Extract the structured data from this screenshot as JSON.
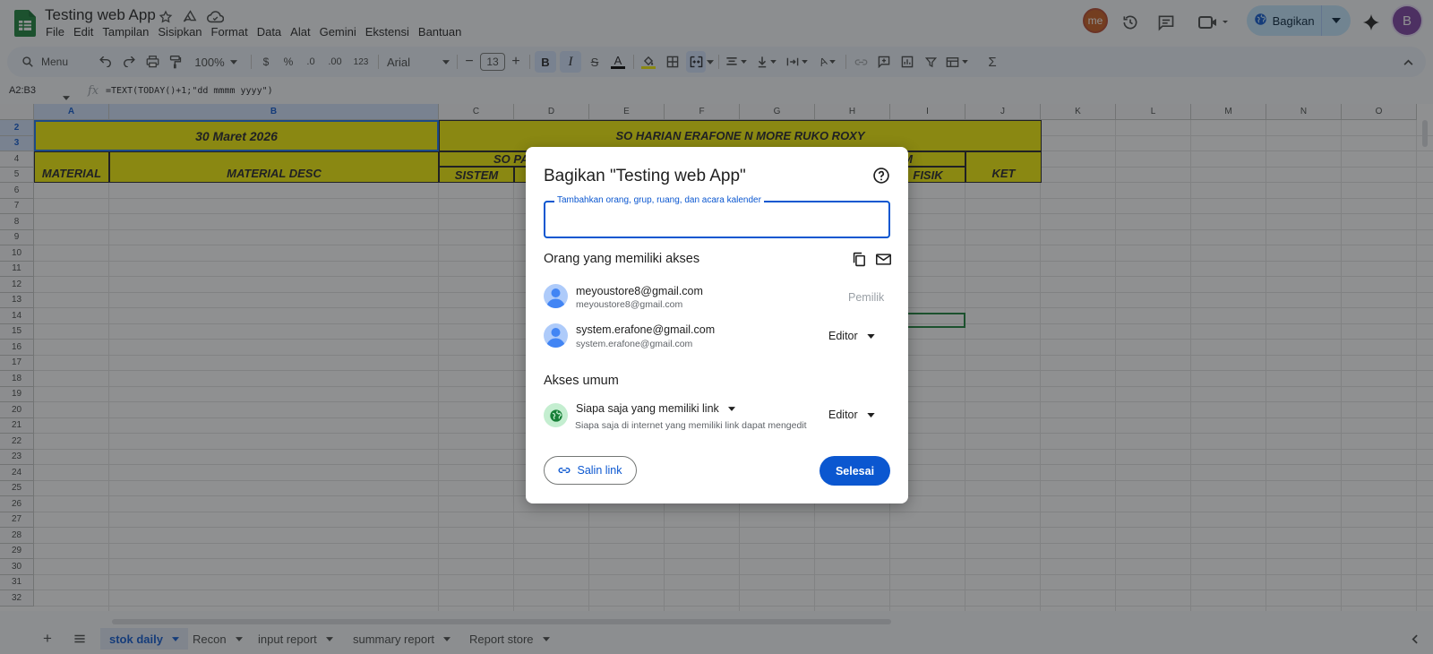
{
  "header": {
    "title": "Testing web App",
    "menu": [
      "File",
      "Edit",
      "Tampilan",
      "Sisipkan",
      "Format",
      "Data",
      "Alat",
      "Gemini",
      "Ekstensi",
      "Bantuan"
    ],
    "share_label": "Bagikan",
    "user_badge": "me",
    "account_initial": "B"
  },
  "toolbar": {
    "menu_search": "Menu",
    "zoom": "100%",
    "currency": "$",
    "percent": "%",
    "dec_minus": ".0",
    "dec_plus": ".00",
    "num_format": "123",
    "font": "Arial",
    "font_size": "13"
  },
  "formula_bar": {
    "name_box": "A2:B3",
    "formula": "=TEXT(TODAY()+1;\"dd mmmm yyyy\")"
  },
  "grid": {
    "columns": [
      "A",
      "B",
      "C",
      "D",
      "E",
      "F",
      "G",
      "H",
      "I",
      "J",
      "K",
      "L",
      "M",
      "N",
      "O"
    ],
    "rows": [
      "2",
      "3",
      "4",
      "5",
      "6",
      "7",
      "8",
      "9",
      "10",
      "11",
      "12",
      "13",
      "14",
      "15",
      "16",
      "17",
      "18",
      "19",
      "20",
      "21",
      "22",
      "23",
      "24",
      "25",
      "26",
      "27",
      "28",
      "29",
      "30",
      "31",
      "32"
    ],
    "cells": {
      "date": "30 Maret 2026",
      "material": "MATERIAL",
      "material_desc": "MATERIAL DESC",
      "title": "SO HARIAN ERAFONE N MORE RUKO ROXY",
      "so_pa": "SO PA",
      "am": "AM",
      "sistem": "SISTEM",
      "fisik": "FISIK",
      "ket": "KET"
    }
  },
  "dialog": {
    "title": "Bagikan \"Testing web App\"",
    "input_label": "Tambahkan orang, grup, ruang, dan acara kalender",
    "people_heading": "Orang yang memiliki akses",
    "people": [
      {
        "name": "meyoustore8@gmail.com",
        "email": "meyoustore8@gmail.com",
        "role": "Pemilik"
      },
      {
        "name": "system.erafone@gmail.com",
        "email": "system.erafone@gmail.com",
        "role": "Editor"
      }
    ],
    "general_heading": "Akses umum",
    "general_access": "Siapa saja yang memiliki link",
    "general_desc": "Siapa saja di internet yang memiliki link dapat mengedit",
    "general_role": "Editor",
    "copy_link": "Salin link",
    "done": "Selesai"
  },
  "sheets": {
    "tabs": [
      "stok daily",
      "Recon",
      "input report",
      "summary report",
      "Report store"
    ],
    "active": "stok daily"
  },
  "colors": {
    "accent": "#0b57d0",
    "cell_fill": "#f4ef00",
    "sheets_green": "#188038"
  }
}
